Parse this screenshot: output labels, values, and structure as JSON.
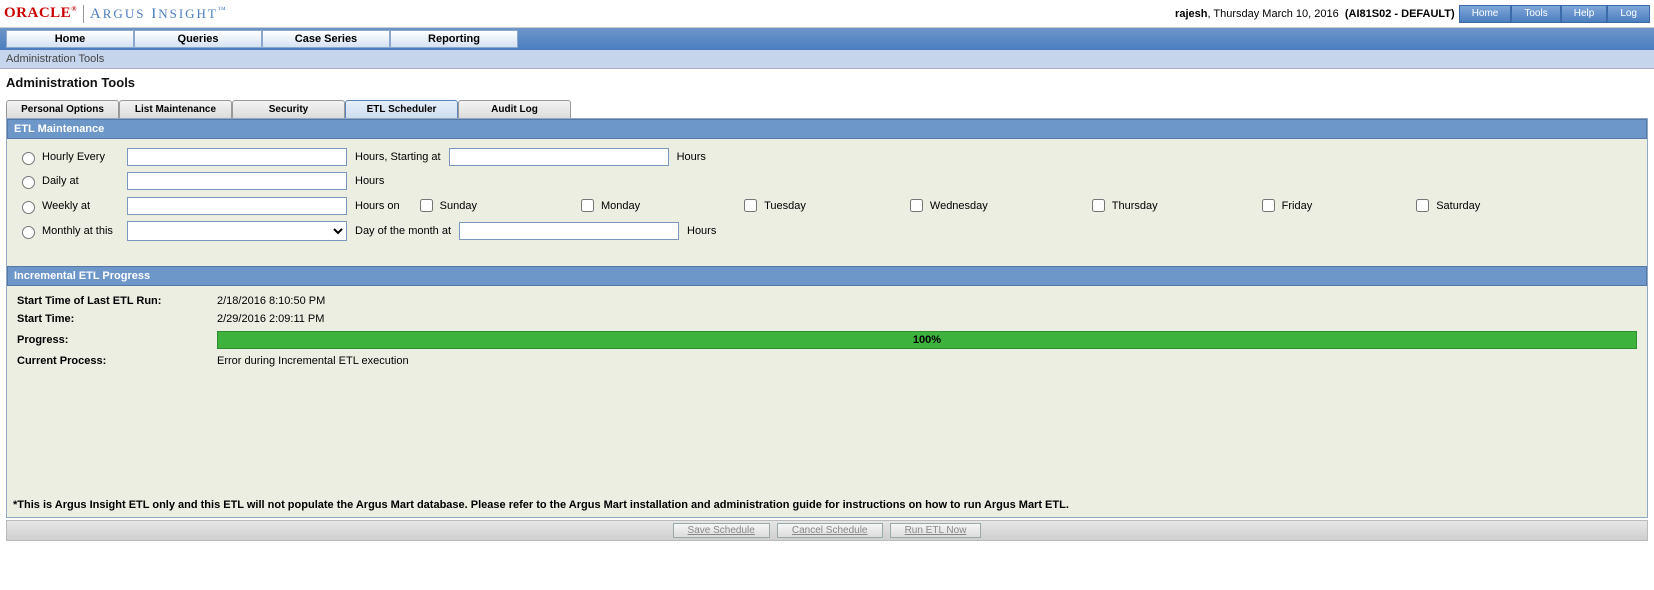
{
  "header": {
    "oracle": "ORACLE",
    "argus": "ARGUS INSIGHT",
    "user": "rajesh",
    "date": "Thursday March 10, 2016",
    "env": "(AI81S02 - DEFAULT)",
    "buttons": {
      "home": "Home",
      "tools": "Tools",
      "help": "Help",
      "log": "Log"
    }
  },
  "nav": {
    "home": "Home",
    "queries": "Queries",
    "case_series": "Case Series",
    "reporting": "Reporting"
  },
  "breadcrumb": "Administration Tools",
  "page_title": "Administration Tools",
  "subtabs": {
    "personal": "Personal Options",
    "listmaint": "List Maintenance",
    "security": "Security",
    "etl": "ETL Scheduler",
    "audit": "Audit Log"
  },
  "etl_maint": {
    "title": "ETL Maintenance",
    "hourly_label": "Hourly Every",
    "hourly_after1": "Hours, Starting at",
    "hourly_after2": "Hours",
    "daily_label": "Daily at",
    "daily_after": "Hours",
    "weekly_label": "Weekly at",
    "weekly_after": "Hours on",
    "monthly_label": "Monthly at this",
    "monthly_mid": "Day of the month at",
    "monthly_after": "Hours",
    "days": {
      "sun": "Sunday",
      "mon": "Monday",
      "tue": "Tuesday",
      "wed": "Wednesday",
      "thu": "Thursday",
      "fri": "Friday",
      "sat": "Saturday"
    }
  },
  "incr": {
    "title": "Incremental ETL Progress",
    "last_label": "Start Time of Last ETL Run:",
    "last_val": "2/18/2016 8:10:50 PM",
    "start_label": "Start Time:",
    "start_val": "2/29/2016 2:09:11 PM",
    "prog_label": "Progress:",
    "prog_val": "100%",
    "cur_label": "Current Process:",
    "cur_val": "Error during Incremental ETL execution"
  },
  "note": "*This is Argus Insight ETL only and this ETL will not populate the Argus Mart database. Please refer to the Argus Mart installation and administration guide for instructions on how to run Argus Mart ETL.",
  "footer": {
    "save": "Save Schedule",
    "cancel": "Cancel Schedule",
    "run": "Run ETL Now"
  }
}
